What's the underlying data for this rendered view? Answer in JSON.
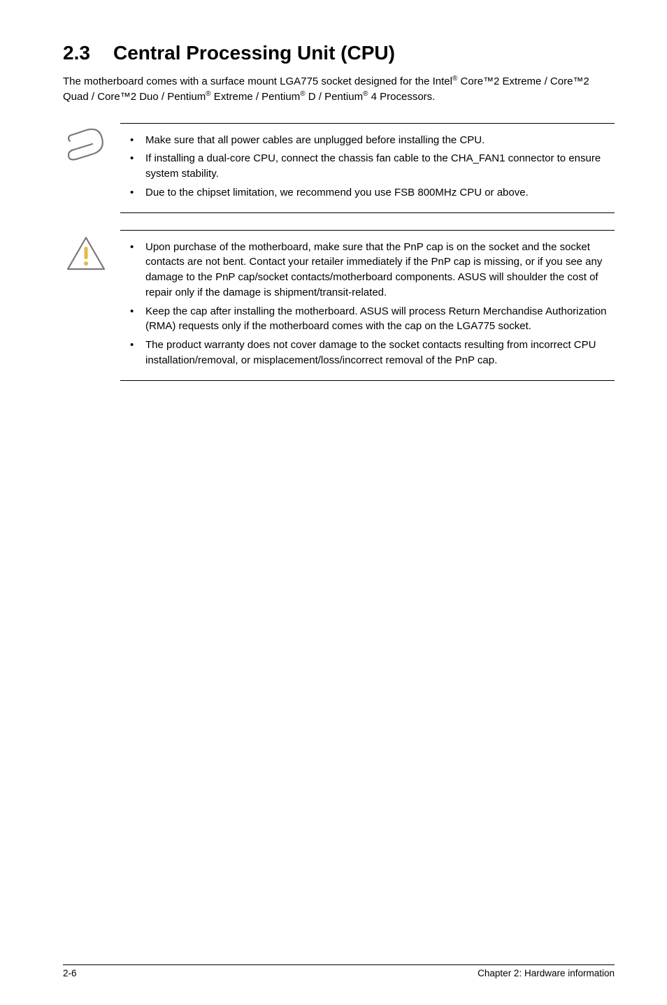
{
  "heading": {
    "num": "2.3",
    "title": "Central Processing Unit (CPU)"
  },
  "intro": {
    "t1": "The motherboard comes with a surface mount LGA775 socket designed for the Intel",
    "s1": "®",
    "t2": " Core™2 Extreme / Core™2 Quad / Core™2 Duo / Pentium",
    "s2": "®",
    "t3": " Extreme / Pentium",
    "s3": "®",
    "t4": " D / Pentium",
    "s4": "®",
    "t5": " 4 Processors."
  },
  "note1": [
    "Make sure that all power cables are unplugged before installing the CPU.",
    "If installing a dual-core CPU, connect the chassis fan cable to the CHA_FAN1 connector to ensure system stability.",
    "Due to the chipset limitation, we recommend you use FSB 800MHz CPU or above."
  ],
  "note2": [
    "Upon purchase of the motherboard, make sure that the PnP cap is on the socket and the socket contacts are not bent. Contact your retailer immediately if the PnP cap is missing, or if you see any damage to the PnP cap/socket contacts/motherboard components. ASUS will shoulder the cost of repair only if the damage is shipment/transit-related.",
    "Keep the cap after installing the motherboard. ASUS will process Return Merchandise Authorization (RMA) requests only if the motherboard comes with the cap on the LGA775 socket.",
    "The product warranty does not cover damage to the socket contacts resulting from incorrect CPU installation/removal, or misplacement/loss/incorrect removal of the PnP cap."
  ],
  "footer": {
    "left": "2-6",
    "right": "Chapter 2: Hardware information"
  }
}
